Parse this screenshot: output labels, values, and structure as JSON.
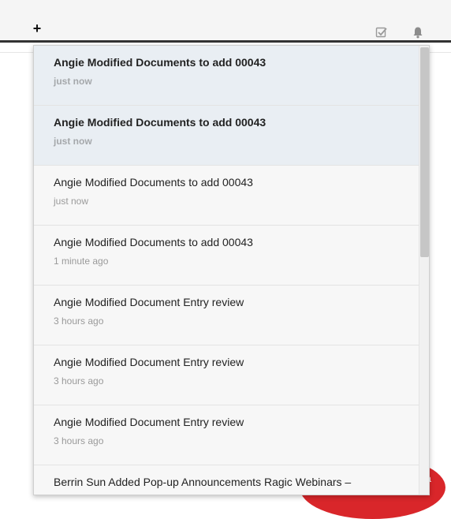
{
  "topbar": {
    "add_label": "+",
    "icons": [
      "tasks-checkbox-icon",
      "bell-icon"
    ]
  },
  "background": {
    "floating_button_text": "ta"
  },
  "notifications": [
    {
      "title": "Angie Modified Documents to add 00043",
      "time": "just now",
      "unread": true
    },
    {
      "title": "Angie Modified Documents to add 00043",
      "time": "just now",
      "unread": true
    },
    {
      "title": "Angie Modified Documents to add 00043",
      "time": "just now",
      "unread": false
    },
    {
      "title": "Angie Modified Documents to add 00043",
      "time": "1 minute ago",
      "unread": false
    },
    {
      "title": "Angie Modified Document Entry review",
      "time": "3 hours ago",
      "unread": false
    },
    {
      "title": "Angie Modified Document Entry review",
      "time": "3 hours ago",
      "unread": false
    },
    {
      "title": "Angie Modified Document Entry review",
      "time": "3 hours ago",
      "unread": false
    },
    {
      "title": "Berrin Sun Added Pop-up Announcements Ragic Webinars –",
      "time": "",
      "unread": false
    }
  ],
  "colors": {
    "unread_bg": "#e9eef3",
    "read_bg": "#f7f7f7",
    "accent_red": "#d9262a",
    "topbar_border": "#333333"
  }
}
